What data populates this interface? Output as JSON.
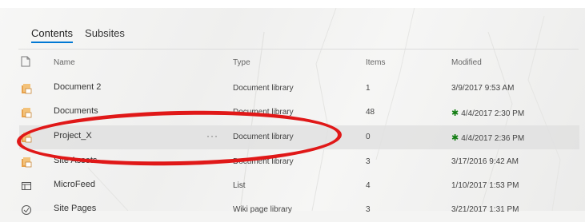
{
  "tabs": [
    {
      "label": "Contents",
      "active": true
    },
    {
      "label": "Subsites",
      "active": false
    }
  ],
  "columns": {
    "name": "Name",
    "type": "Type",
    "items": "Items",
    "modified": "Modified"
  },
  "rows": [
    {
      "name": "Document 2",
      "type": "Document library",
      "items": "1",
      "modified": "3/9/2017 9:53 AM",
      "new": false,
      "icon": "library-icon"
    },
    {
      "name": "Documents",
      "type": "Document library",
      "items": "48",
      "modified": "4/4/2017 2:30 PM",
      "new": true,
      "icon": "library-icon"
    },
    {
      "name": "Project_X",
      "type": "Document library",
      "items": "0",
      "modified": "4/4/2017 2:36 PM",
      "new": true,
      "icon": "library-icon",
      "more": "···"
    },
    {
      "name": "Site Assets",
      "type": "Document library",
      "items": "3",
      "modified": "3/17/2016 9:42 AM",
      "new": false,
      "icon": "library-icon"
    },
    {
      "name": "MicroFeed",
      "type": "List",
      "items": "4",
      "modified": "1/10/2017 1:53 PM",
      "new": false,
      "icon": "list-icon"
    },
    {
      "name": "Site Pages",
      "type": "Wiki page library",
      "items": "3",
      "modified": "3/21/2017 1:31 PM",
      "new": false,
      "icon": "pages-icon"
    }
  ],
  "new_marker": "✱",
  "colors": {
    "accent": "#0078d4",
    "new": "#107c10",
    "highlight": "#e01818"
  }
}
